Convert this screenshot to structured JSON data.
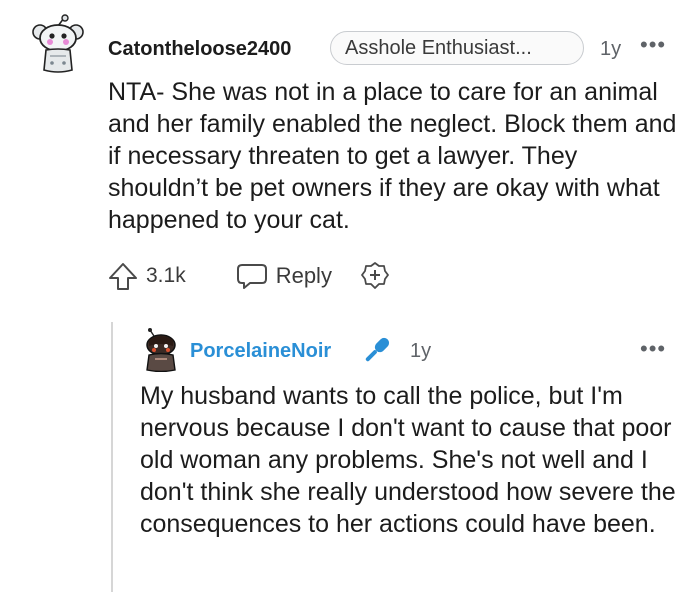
{
  "comment": {
    "username": "Catontheloose2400",
    "flair": "Asshole Enthusiast...",
    "time": "1y",
    "more": "•••",
    "body": "NTA- She was not in a place to care for an animal and her family enabled the neglect. Block them and if necessary threaten to get a lawyer. They shouldn’t be pet owners if they are okay with what happened to your cat.",
    "votes": "3.1k",
    "reply_label": "Reply"
  },
  "reply": {
    "username": "PorcelaineNoir",
    "time": "1y",
    "more": "•••",
    "body": "My husband wants to call the police, but I'm nervous because I don't want to cause that poor old woman any problems. She's not well and I don't think she really understood how severe the consequences to her actions could have been."
  },
  "colors": {
    "username_op": "#2a8fd6",
    "muted": "#5f6368",
    "thread_line": "#d6d6d6"
  }
}
